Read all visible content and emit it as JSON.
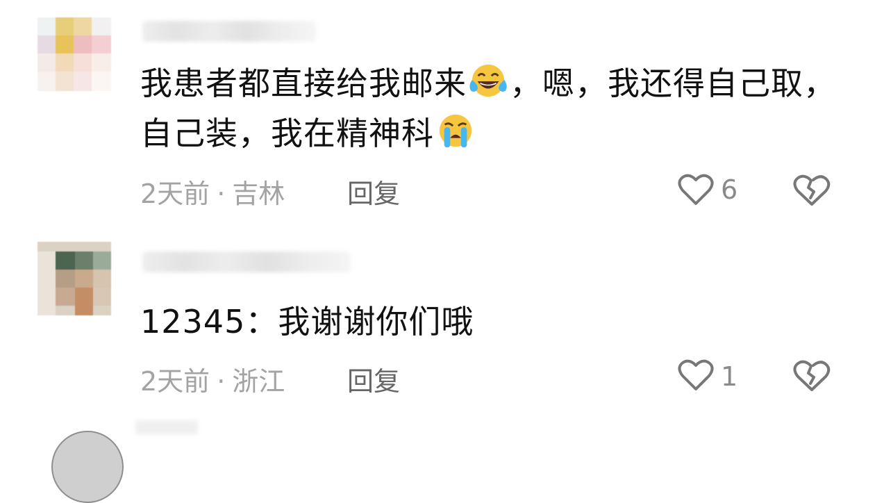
{
  "comments": [
    {
      "text_before": "我患者都直接给我邮来",
      "emoji1": "laughing-crying-emoji",
      "text_middle": "，嗯，我还得自己取，自己装，我在精神科",
      "emoji2": "loudly-crying-emoji",
      "time": "2天前",
      "separator": "·",
      "location": "吉林",
      "reply_label": "回复",
      "like_count": "6",
      "icons": {
        "like": "heart-outline-icon",
        "dislike": "broken-heart-icon"
      }
    },
    {
      "text": "12345：我谢谢你们哦",
      "time": "2天前",
      "separator": "·",
      "location": "浙江",
      "reply_label": "回复",
      "like_count": "1",
      "icons": {
        "like": "heart-outline-icon",
        "dislike": "broken-heart-icon"
      }
    }
  ],
  "colors": {
    "meta": "#a3a3a3",
    "reply": "#666666",
    "icon": "#777777",
    "text": "#111111"
  }
}
